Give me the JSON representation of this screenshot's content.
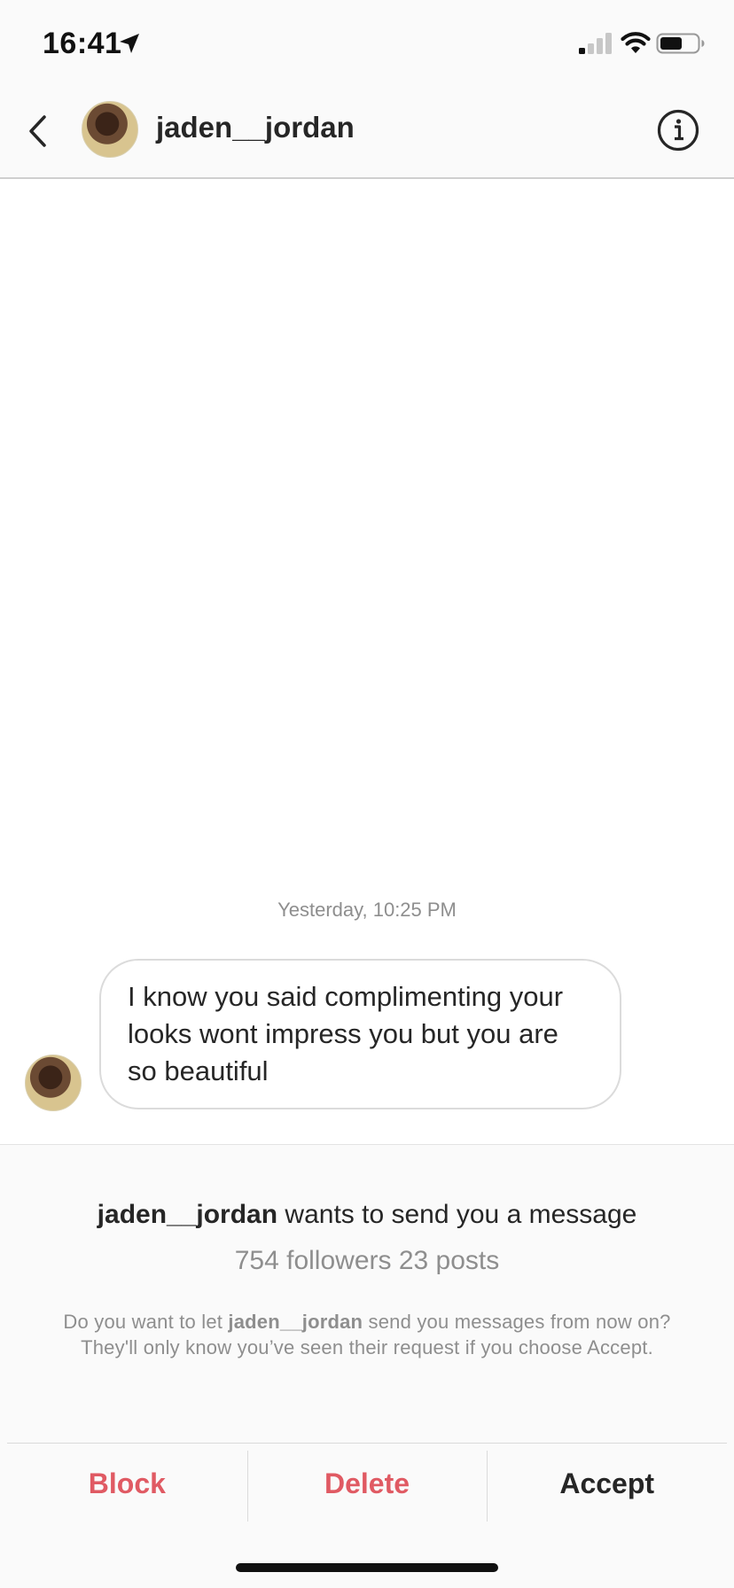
{
  "status_bar": {
    "time": "16:41"
  },
  "header": {
    "username": "jaden__jordan"
  },
  "chat": {
    "timestamp": "Yesterday, 10:25 PM",
    "message": "I know you said complimenting your looks wont impress you but you are so beautiful"
  },
  "request": {
    "sender": "jaden__jordan",
    "title_suffix": " wants to send you a message",
    "stats": "754 followers 23 posts",
    "desc_prefix": "Do you want to let ",
    "desc_sender": "jaden__jordan",
    "desc_suffix": " send you messages from now on? They'll only know you’ve seen their request if you choose Accept."
  },
  "actions": {
    "block": "Block",
    "delete": "Delete",
    "accept": "Accept"
  },
  "colors": {
    "danger": "#e05a63",
    "text": "#262626",
    "muted": "#8e8e8e"
  },
  "icons": {
    "back": "chevron-left-icon",
    "info": "info-icon",
    "location": "location-arrow-icon",
    "signal": "cellular-signal-icon",
    "wifi": "wifi-icon",
    "battery": "battery-icon"
  }
}
